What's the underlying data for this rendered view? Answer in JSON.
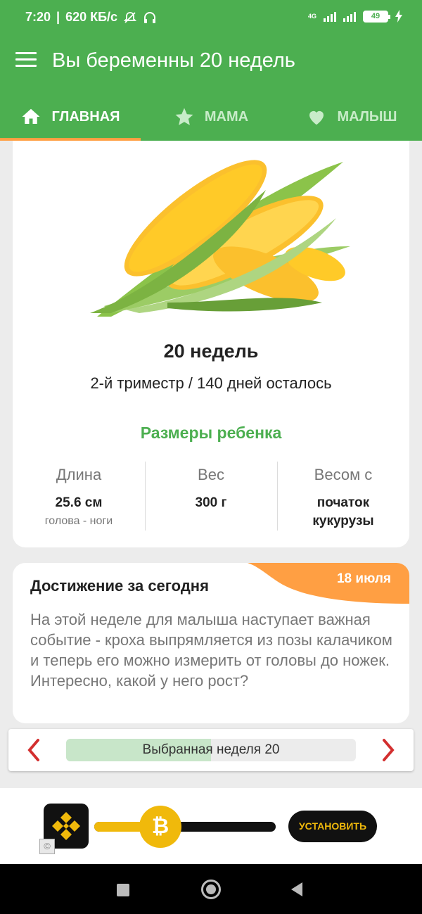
{
  "status_bar": {
    "time": "7:20",
    "speed": "620 КБ/с",
    "network": "4G",
    "battery": "49"
  },
  "app_bar": {
    "title": "Вы беременны 20 недель"
  },
  "tabs": [
    {
      "label": "ГЛАВНАЯ",
      "icon": "home-icon",
      "active": true
    },
    {
      "label": "МАМА",
      "icon": "star-icon",
      "active": false
    },
    {
      "label": "МАЛЫШ",
      "icon": "heart-icon",
      "active": false
    }
  ],
  "week_card": {
    "image": "corn-illustration",
    "weeks": "20 недель",
    "trimester": "2-й триместр / 140 дней осталось",
    "sizes_title": "Размеры ребенка",
    "stats": [
      {
        "label": "Длина",
        "value": "25.6 см",
        "sub": "голова - ноги"
      },
      {
        "label": "Вес",
        "value": "300 г",
        "sub": ""
      },
      {
        "label": "Весом с",
        "value": "початок кукурузы",
        "sub": ""
      }
    ]
  },
  "achievement": {
    "date": "18 июля",
    "title": "Достижение за сегодня",
    "body": "На этой неделе для малыша наступает важная событие - кроха выпрямляется из позы калачиком и теперь его можно измерить от головы до ножек. Интересно, какой у него рост?"
  },
  "week_selector": {
    "label": "Выбранная неделя 20",
    "progress": 0.5
  },
  "ad": {
    "install_label": "УСТАНОВИТЬ",
    "knob_symbol": "₿",
    "info_symbol": "©",
    "slider_progress": 0.3
  },
  "colors": {
    "primary": "#4caf50",
    "accent": "#ff9f43",
    "binance_yellow": "#f0b90b"
  }
}
